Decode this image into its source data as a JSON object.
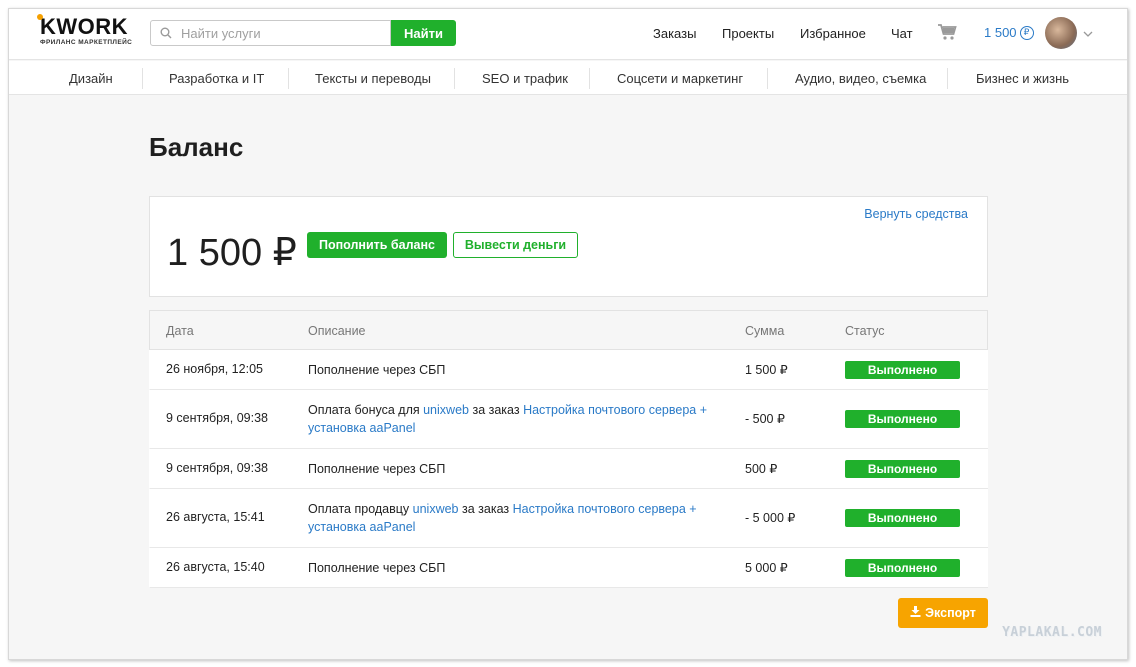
{
  "header": {
    "logo_text": "KWORK",
    "logo_subtitle": "ФРИЛАНС МАРКЕТПЛЕЙС",
    "search_placeholder": "Найти услуги",
    "search_button": "Найти",
    "nav": [
      "Заказы",
      "Проекты",
      "Избранное",
      "Чат"
    ],
    "balance": "1 500",
    "currency_symbol": "₽"
  },
  "categories": [
    "Дизайн",
    "Разработка и IT",
    "Тексты и переводы",
    "SEO и трафик",
    "Соцсети и маркетинг",
    "Аудио, видео, съемка",
    "Бизнес и жизнь"
  ],
  "page": {
    "title": "Баланс",
    "balance_amount": "1 500 ₽",
    "topup_button": "Пополнить баланс",
    "withdraw_button": "Вывести деньги",
    "refund_link": "Вернуть средства"
  },
  "table": {
    "headers": [
      "Дата",
      "Описание",
      "Сумма",
      "Статус"
    ],
    "rows": [
      {
        "date": "26 ноября, 12:05",
        "desc_text": "Пополнение через СБП",
        "user": "",
        "mid": "",
        "order": "",
        "amount": "1 500 ₽",
        "status": "Выполнено"
      },
      {
        "date": "9 сентября, 09:38",
        "desc_text": "Оплата бонуса для ",
        "user": "unixweb",
        "mid": " за заказ ",
        "order": "Настройка почтового сервера + установка aaPanel",
        "amount": "- 500 ₽",
        "status": "Выполнено"
      },
      {
        "date": "9 сентября, 09:38",
        "desc_text": "Пополнение через СБП",
        "user": "",
        "mid": "",
        "order": "",
        "amount": "500 ₽",
        "status": "Выполнено"
      },
      {
        "date": "26 августа, 15:41",
        "desc_text": "Оплата продавцу ",
        "user": "unixweb",
        "mid": " за заказ ",
        "order": "Настройка почтового сервера + установка aaPanel",
        "amount": "- 5 000 ₽",
        "status": "Выполнено"
      },
      {
        "date": "26 августа, 15:40",
        "desc_text": "Пополнение через СБП",
        "user": "",
        "mid": "",
        "order": "",
        "amount": "5 000 ₽",
        "status": "Выполнено"
      }
    ]
  },
  "export_button": "Экспорт",
  "watermark": "YAPLAKAL.COM",
  "colors": {
    "accent_green": "#20b02c",
    "link_blue": "#2a7ac7",
    "export_orange": "#f7a400"
  }
}
